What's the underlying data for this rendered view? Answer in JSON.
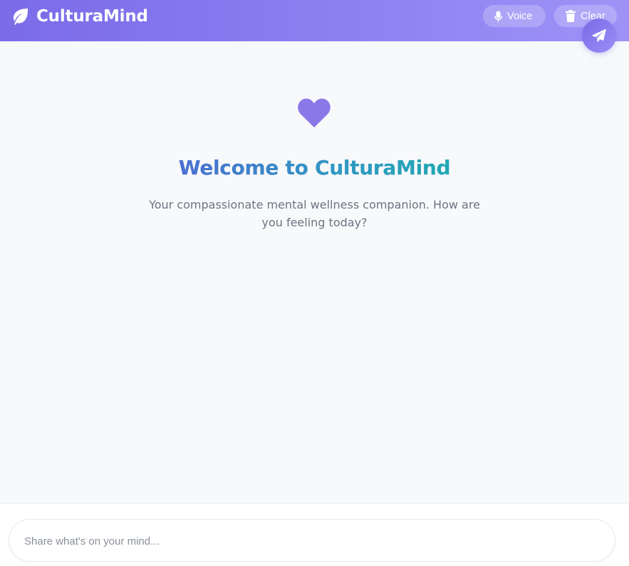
{
  "header": {
    "brand_icon": "leaf-icon",
    "app_name": "CulturaMind",
    "voice_label": "Voice",
    "voice_icon": "microphone-icon",
    "clear_label": "Clear",
    "clear_icon": "trash-icon",
    "gradient_start": "#7b6be8",
    "gradient_end": "#9f93f7"
  },
  "welcome": {
    "icon": "heart-icon",
    "icon_color": "#8b78e8",
    "title": "Welcome to CulturaMind",
    "subtitle": "Your compassionate mental wellness companion. How are you feeling today?"
  },
  "composer": {
    "placeholder": "Share what's on your mind...",
    "value": "",
    "send_icon": "paper-plane-icon",
    "send_color": "#8a7cf0"
  }
}
